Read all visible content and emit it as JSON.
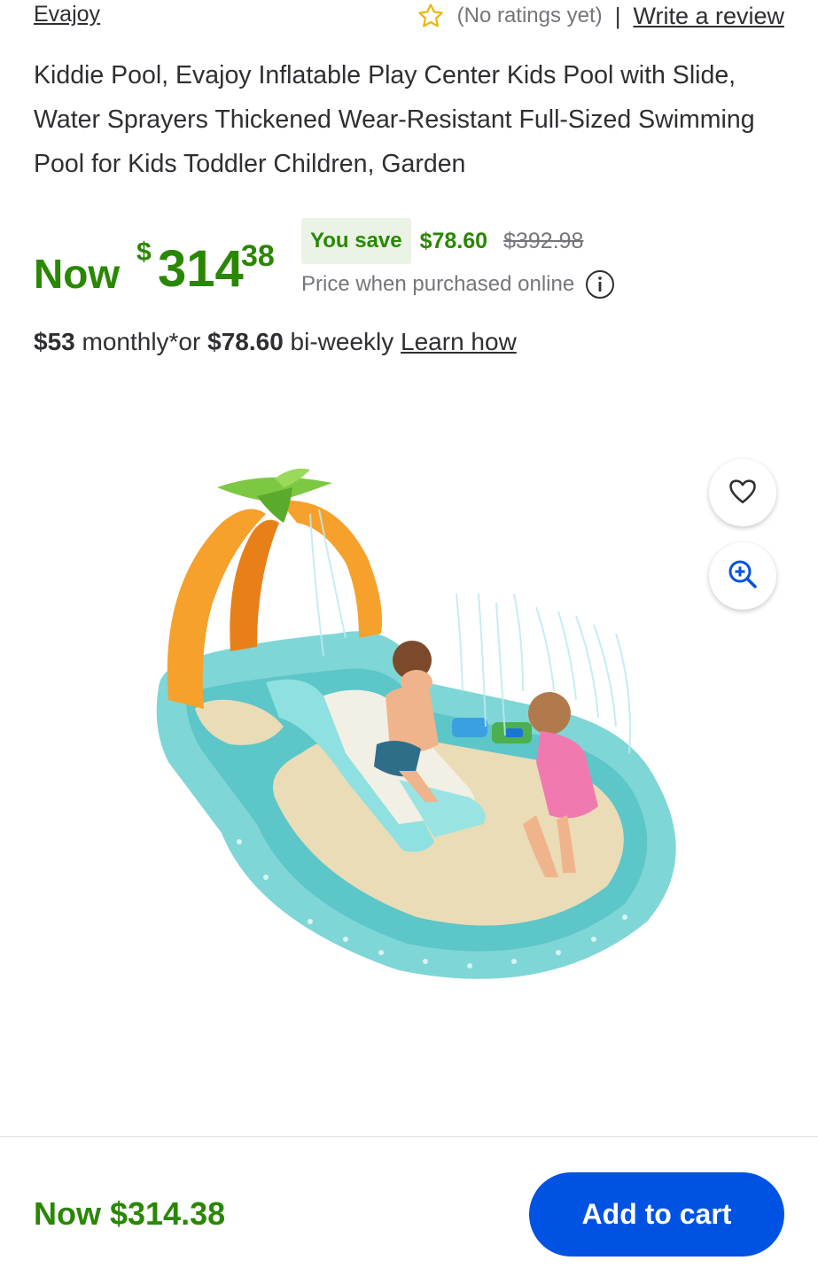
{
  "header": {
    "brand": "Evajoy",
    "ratings_text": "(No ratings yet)",
    "divider": "|",
    "write_review": "Write a review"
  },
  "product": {
    "title": "Kiddie Pool, Evajoy Inflatable Play Center Kids Pool with Slide, Water Sprayers Thickened Wear-Resistant Full-Sized Swimming Pool for Kids Toddler Children, Garden"
  },
  "price": {
    "now_label": "Now",
    "currency": "$",
    "whole": "314",
    "cents": "38",
    "you_save_label": "You save",
    "save_amount": "$78.60",
    "was_price": "$392.98",
    "online_note": "Price when purchased online"
  },
  "financing": {
    "monthly_amount": "$53",
    "monthly_text": " monthly*or ",
    "biweekly_amount": "$78.60",
    "biweekly_text": " bi-weekly ",
    "learn_how": "Learn how"
  },
  "bottom_bar": {
    "price": "Now $314.38",
    "add_to_cart": "Add to cart"
  },
  "colors": {
    "price_green": "#2a8703",
    "save_badge_bg": "#eaf3e6",
    "cart_blue": "#0053e2",
    "star": "#f2b203"
  },
  "icons": {
    "rating": "star-outline-icon",
    "info": "info-circle-icon",
    "favorite": "heart-icon",
    "zoom": "zoom-in-icon"
  }
}
